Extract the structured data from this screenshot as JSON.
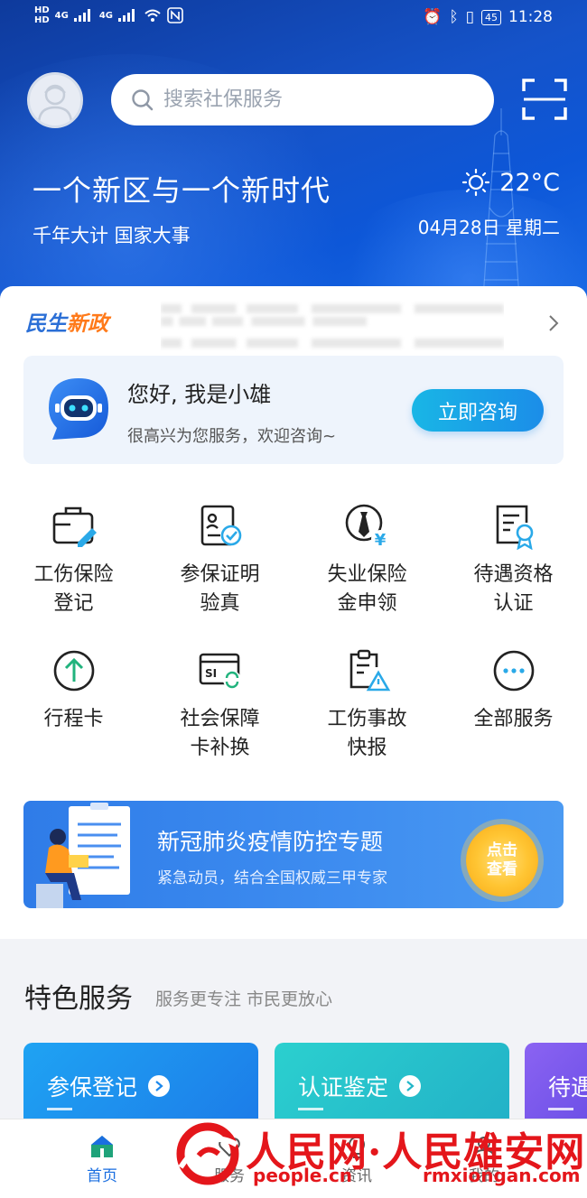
{
  "status_bar": {
    "time": "11:28",
    "battery": "45",
    "network": "4G"
  },
  "search": {
    "placeholder": "搜索社保服务"
  },
  "hero": {
    "headline": "一个新区与一个新时代",
    "subline": "千年大计 国家大事",
    "temperature": "22°C",
    "date": "04月28日 星期二"
  },
  "news": {
    "brand_part1": "民生",
    "brand_part2": "新政"
  },
  "assistant": {
    "greeting": "您好, 我是小雄",
    "subtitle": "很高兴为您服务，欢迎咨询~",
    "button": "立即咨询"
  },
  "services": [
    {
      "label": "工伤保险\n登记",
      "icon": "briefcase-edit-icon"
    },
    {
      "label": "参保证明\n验真",
      "icon": "id-card-check-icon"
    },
    {
      "label": "失业保险\n金申领",
      "icon": "tie-yuan-icon"
    },
    {
      "label": "待遇资格\n认证",
      "icon": "certificate-badge-icon"
    },
    {
      "label": "行程卡",
      "icon": "arrow-up-circle-icon"
    },
    {
      "label": "社会保障\n卡补换",
      "icon": "si-card-refresh-icon"
    },
    {
      "label": "工伤事故\n快报",
      "icon": "clipboard-warning-icon"
    },
    {
      "label": "全部服务",
      "icon": "more-circle-icon"
    }
  ],
  "banner": {
    "title": "新冠肺炎疫情防控专题",
    "subtitle": "紧急动员，结合全国权威三甲专家",
    "action": "点击\n查看"
  },
  "featured": {
    "title": "特色服务",
    "subtitle": "服务更专注 市民更放心",
    "cards": [
      {
        "label": "参保登记",
        "color": "#1f8ff0"
      },
      {
        "label": "认证鉴定",
        "color": "#27c1c9"
      },
      {
        "label": "待遇",
        "color": "#7a5cf0"
      }
    ]
  },
  "tabbar": [
    {
      "label": "首页",
      "active": true
    },
    {
      "label": "服务",
      "active": false
    },
    {
      "label": "资讯",
      "active": false
    },
    {
      "label": "我的",
      "active": false
    }
  ],
  "watermark": {
    "title": "人民网·人民雄安网",
    "domain1": "people.cn",
    "domain2": "rmxiongan.com"
  }
}
